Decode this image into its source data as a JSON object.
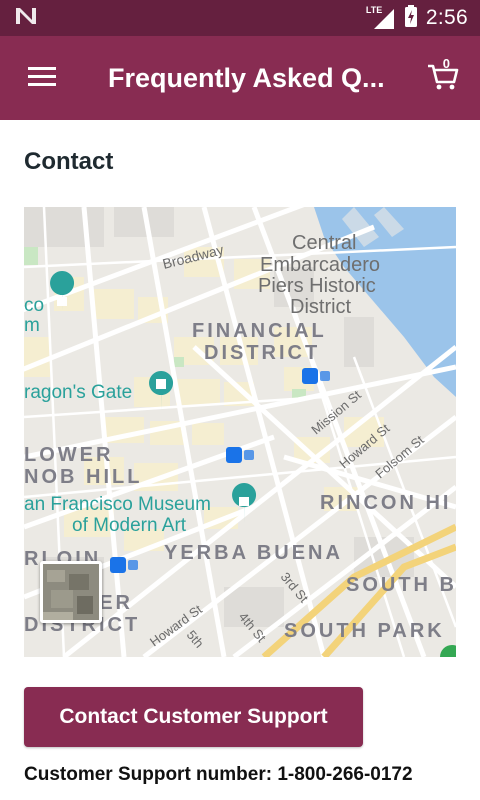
{
  "status_bar": {
    "time": "2:56",
    "network": "LTE",
    "colors": {
      "background": "#65203f"
    }
  },
  "app_bar": {
    "title": "Frequently Asked Q...",
    "cart_count": "0",
    "colors": {
      "background": "#882c52"
    }
  },
  "contact": {
    "heading": "Contact",
    "map": {
      "labels": {
        "broadway": "Broadway",
        "central_embarcadero": [
          "Central",
          "Embarcadero",
          "Piers Historic",
          "District"
        ],
        "financial_district": [
          "FINANCIAL",
          "DISTRICT"
        ],
        "dragons_gate": "ragon's Gate",
        "lower_nob_hill": [
          "LOWER",
          "NOB HILL"
        ],
        "sfmoma": [
          "an Francisco Museum",
          "of Modern Art"
        ],
        "mission_st": "Mission St",
        "howard_st": "Howard St",
        "folsom_st": "Folsom St",
        "rincon_hill": "RINCON HI",
        "yerba_buena": "YERBA BUENA",
        "south_beach": "SOUTH B",
        "south_park": "SOUTH PARK",
        "third_st": "3rd St",
        "fourth_st": "4th St",
        "fifth_st": "5th",
        "howard_st_2": "Howard St",
        "tenderloin_part": "RLOIN",
        "district_part": [
          "TER",
          "DISTRICT"
        ],
        "museum_left": [
          "co",
          "m"
        ]
      }
    },
    "button_label": "Contact Customer Support",
    "support_text": "Customer Support number: 1-800-266-0172"
  },
  "icons": {
    "logo": "n-notification-icon",
    "signal": "lte-signal-icon",
    "battery": "battery-charging-icon",
    "menu": "hamburger-menu-icon",
    "cart": "shopping-cart-icon"
  }
}
